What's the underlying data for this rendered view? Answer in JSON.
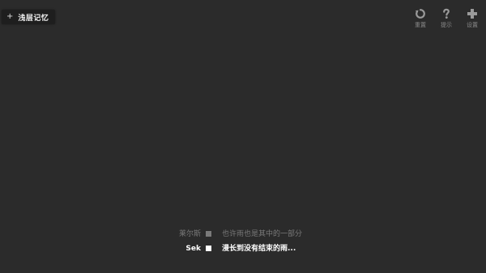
{
  "memory_button": {
    "plus": "+",
    "label": "浅层记忆"
  },
  "toolbar": {
    "reset_label": "重置",
    "hint_label": "提示",
    "settings_label": "设置"
  },
  "dialogue": [
    {
      "speaker": "莱尔斯",
      "text": "也许雨也是其中的一部分"
    },
    {
      "speaker": "Sek",
      "text": "漫长到没有结束的雨..."
    }
  ],
  "colors": {
    "background": "#2b2b2b",
    "button_bg": "#1e1e1e",
    "current_text": "#ffffff",
    "past_text": "#7a7a7a",
    "icon": "#9a9a9a"
  }
}
